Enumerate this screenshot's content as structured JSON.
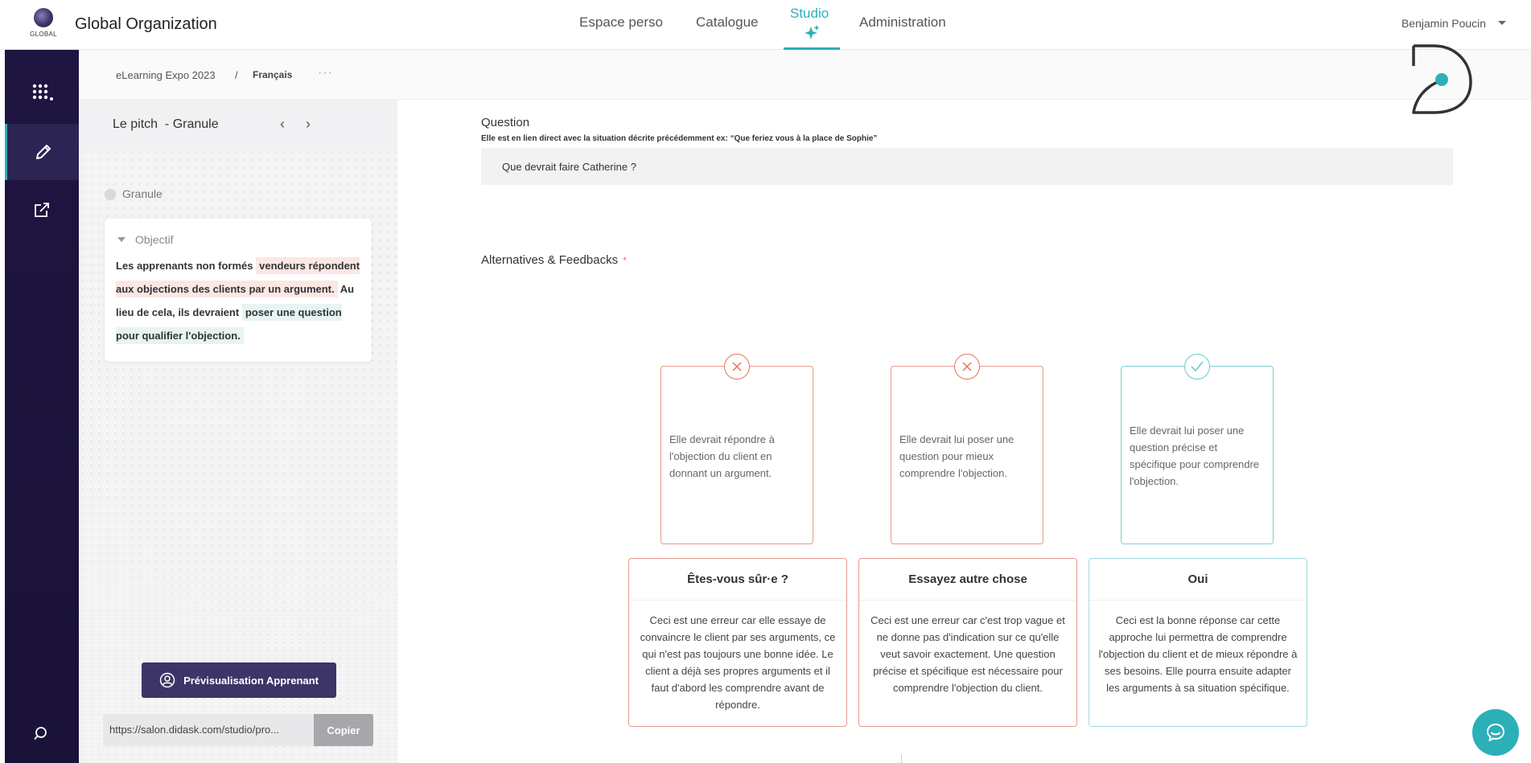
{
  "org": {
    "logo_text": "GLOBAL",
    "name": "Global Organization"
  },
  "nav": [
    {
      "label": "Espace perso"
    },
    {
      "label": "Catalogue"
    },
    {
      "label": "Studio"
    },
    {
      "label": "Administration"
    }
  ],
  "user": {
    "name": "Benjamin Poucin"
  },
  "breadcrumb": {
    "course": "eLearning Expo 2023",
    "separator": "/",
    "language": "Français",
    "more": "···"
  },
  "panel": {
    "title": "Le pitch  - Granule",
    "granule_label": "Granule",
    "objective": {
      "title": "Objectif",
      "part1": "Les apprenants non formés",
      "part2": "vendeurs répondent aux objections des clients par un argument.",
      "part3": "Au lieu de cela, ils devraient",
      "part4": "poser une question pour qualifier l'objection."
    },
    "preview_button": "Prévisualisation Apprenant",
    "url": "https://salon.didask.com/studio/pro...",
    "copy_button": "Copier"
  },
  "question": {
    "label": "Question",
    "hint": "Elle est en lien direct avec la situation décrite précédemment ex: “Que feriez vous à la place de Sophie”",
    "value": "Que devrait faire Catherine ?"
  },
  "alternatives": {
    "label": "Alternatives & Feedbacks",
    "required_mark": "*",
    "items": [
      {
        "status": "wrong",
        "text": "Elle devrait répondre à l'objection du client en donnant un argument.",
        "feedback_title": "Êtes-vous sûr·e ?",
        "feedback_text": "Ceci est une erreur car elle essaye de convaincre le client par ses arguments, ce qui n'est pas toujours une bonne idée. Le client a déjà ses propres arguments et il faut d'abord les comprendre avant de répondre."
      },
      {
        "status": "wrong",
        "text": "Elle devrait lui poser une question pour mieux comprendre l'objection.",
        "feedback_title": "Essayez autre chose",
        "feedback_text": "Ceci est une erreur car c'est trop vague et ne donne pas d'indication sur ce qu'elle veut savoir exactement. Une question précise et spécifique est nécessaire pour comprendre l'objection du client."
      },
      {
        "status": "right",
        "text": "Elle devrait lui poser une question précise et spécifique pour comprendre l'objection.",
        "feedback_title": "Oui",
        "feedback_text": "Ceci est la bonne réponse car cette approche lui permettra de comprendre l'objection du client et de mieux répondre à ses besoins. Elle pourra ensuite adapter les arguments à sa situation spécifique."
      }
    ]
  },
  "colors": {
    "accent": "#2bb0b8",
    "rail": "#1f1541",
    "wrong": "#e8735c",
    "right": "#6cc8cf",
    "button": "#3d3566"
  }
}
